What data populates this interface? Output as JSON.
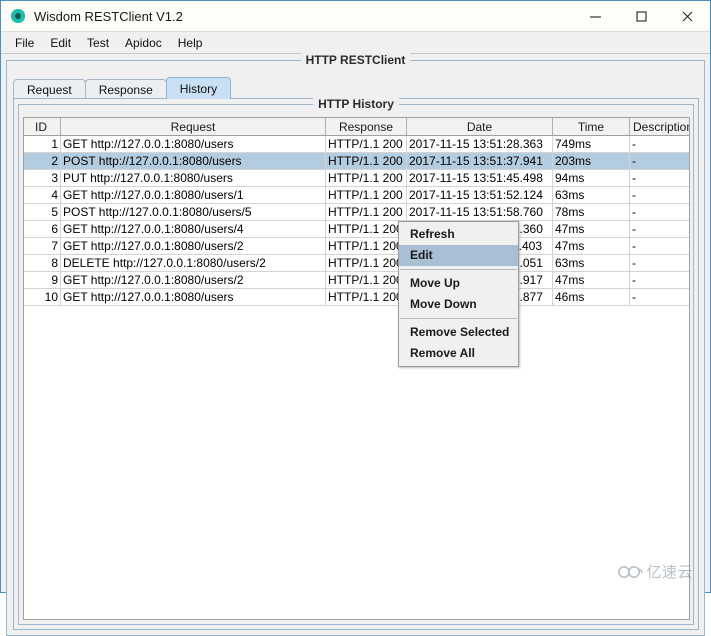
{
  "window": {
    "title": "Wisdom RESTClient V1.2",
    "app_icon": "circle-teal-icon",
    "controls": {
      "minimize": "minimize-icon",
      "maximize": "maximize-icon",
      "close": "close-icon"
    }
  },
  "menubar": {
    "items": [
      {
        "label": "File"
      },
      {
        "label": "Edit"
      },
      {
        "label": "Test"
      },
      {
        "label": "Apidoc"
      },
      {
        "label": "Help"
      }
    ]
  },
  "panels": {
    "restclient_title": "HTTP RESTClient",
    "history_title": "HTTP History"
  },
  "tabs": [
    {
      "label": "Request",
      "selected": false
    },
    {
      "label": "Response",
      "selected": false
    },
    {
      "label": "History",
      "selected": true
    }
  ],
  "table": {
    "columns": [
      "ID",
      "Request",
      "Response",
      "Date",
      "Time",
      "Description"
    ],
    "rows": [
      {
        "id": "1",
        "request": "GET http://127.0.0.1:8080/users",
        "response": "HTTP/1.1 200",
        "date": "2017-11-15 13:51:28.363",
        "time": "749ms",
        "description": "-",
        "selected": false
      },
      {
        "id": "2",
        "request": "POST http://127.0.0.1:8080/users",
        "response": "HTTP/1.1 200",
        "date": "2017-11-15 13:51:37.941",
        "time": "203ms",
        "description": "-",
        "selected": true
      },
      {
        "id": "3",
        "request": "PUT http://127.0.0.1:8080/users",
        "response": "HTTP/1.1 200",
        "date": "2017-11-15 13:51:45.498",
        "time": "94ms",
        "description": "-",
        "selected": false
      },
      {
        "id": "4",
        "request": "GET http://127.0.0.1:8080/users/1",
        "response": "HTTP/1.1 200",
        "date": "2017-11-15 13:51:52.124",
        "time": "63ms",
        "description": "-",
        "selected": false
      },
      {
        "id": "5",
        "request": "POST http://127.0.0.1:8080/users/5",
        "response": "HTTP/1.1 200",
        "date": "2017-11-15 13:51:58.760",
        "time": "78ms",
        "description": "-",
        "selected": false
      },
      {
        "id": "6",
        "request": "GET http://127.0.0.1:8080/users/4",
        "response": "HTTP/1.1 200",
        "date": "2017-11-15 13:52:05.360",
        "time": "47ms",
        "description": "-",
        "selected": false
      },
      {
        "id": "7",
        "request": "GET http://127.0.0.1:8080/users/2",
        "response": "HTTP/1.1 200",
        "date": "2017-11-15 13:52:11.403",
        "time": "47ms",
        "description": "-",
        "selected": false
      },
      {
        "id": "8",
        "request": "DELETE http://127.0.0.1:8080/users/2",
        "response": "HTTP/1.1 200",
        "date": "2017-11-15 13:52:18.051",
        "time": "63ms",
        "description": "-",
        "selected": false
      },
      {
        "id": "9",
        "request": "GET http://127.0.0.1:8080/users/2",
        "response": "HTTP/1.1 200",
        "date": "2017-11-15 13:52:24.917",
        "time": "47ms",
        "description": "-",
        "selected": false
      },
      {
        "id": "10",
        "request": "GET http://127.0.0.1:8080/users",
        "response": "HTTP/1.1 200",
        "date": "2017-11-15 13:52:31.877",
        "time": "46ms",
        "description": "-",
        "selected": false
      }
    ]
  },
  "context_menu": {
    "items": [
      {
        "label": "Refresh",
        "highlight": false,
        "separator_after": false
      },
      {
        "label": "Edit",
        "highlight": true,
        "separator_after": true
      },
      {
        "label": "Move Up",
        "highlight": false,
        "separator_after": false
      },
      {
        "label": "Move Down",
        "highlight": false,
        "separator_after": true
      },
      {
        "label": "Remove Selected",
        "highlight": false,
        "separator_after": false
      },
      {
        "label": "Remove All",
        "highlight": false,
        "separator_after": false
      }
    ]
  },
  "watermark": {
    "text": "亿速云",
    "icon": "cloud-icon"
  },
  "colors": {
    "selection": "#b4ccdf",
    "menu_highlight": "#a8bfd4",
    "tab_selected": "#c9e0f4",
    "frame_border": "#4a90c4",
    "app_icon": "#1fbba6"
  }
}
